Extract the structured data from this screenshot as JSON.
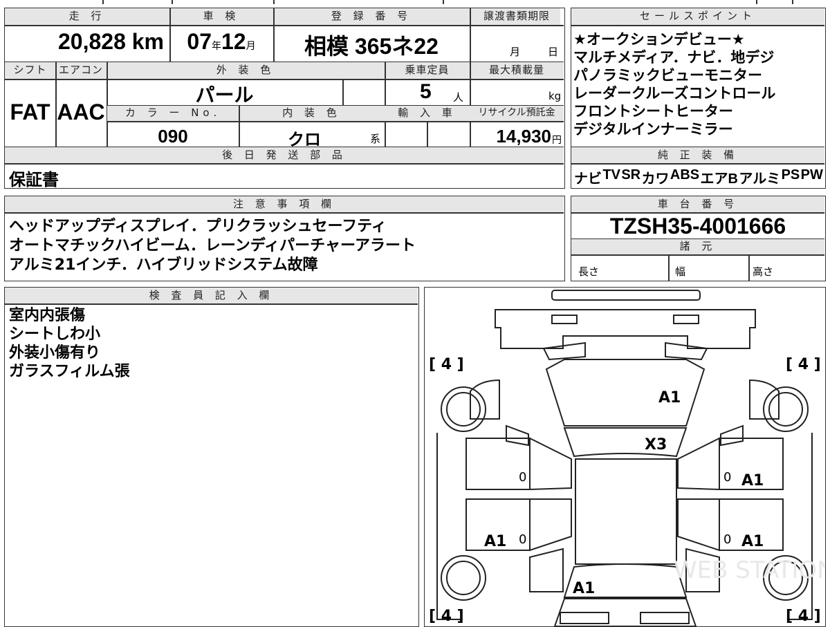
{
  "summary": {
    "mileage_header": "走 行",
    "mileage_value": "20,828",
    "mileage_unit": "km",
    "inspection_header": "車 検",
    "inspection_year": "07",
    "inspection_year_unit": "年",
    "inspection_month": "12",
    "inspection_month_unit": "月",
    "registration_header": "登 録 番 号",
    "registration_value": "相模 365ネ22",
    "transfer_header": "譲渡書類期限",
    "transfer_month_unit": "月",
    "transfer_day_unit": "日",
    "shift_header": "シフト",
    "shift_value": "FAT",
    "ac_header": "エアコン",
    "ac_value": "AAC",
    "exterior_header": "外 装 色",
    "exterior_value": "パール",
    "capacity_header": "乗車定員",
    "capacity_value": "5",
    "capacity_unit": "人",
    "load_header": "最大積載量",
    "load_unit": "kg",
    "color_no_header": "カ ラ ー No.",
    "color_no_value": "090",
    "interior_header": "内 装 色",
    "interior_value": "クロ",
    "interior_suffix": "系",
    "import_header": "輸 入 車",
    "recycle_header": "リサイクル預託金",
    "recycle_value": "14,930",
    "recycle_unit": "円",
    "later_parts_header": "後 日 発 送 部 品",
    "later_parts_value": "保証書"
  },
  "sales_points": {
    "header": "セールスポイント",
    "items": [
      "★オークションデビュー★",
      "マルチメディア．ナビ．地デジ",
      "パノラミックビューモニター",
      "レーダークルーズコントロール",
      "フロントシートヒーター",
      "デジタルインナーミラー"
    ]
  },
  "equipment": {
    "header": "純 正 装 備",
    "items": [
      "ナビ",
      "TV",
      "SR",
      "カワ",
      "ABS",
      "エアB",
      "アルミ",
      "PS",
      "PW"
    ]
  },
  "notes": {
    "header": "注 意 事 項 欄",
    "lines": [
      "ヘッドアップディスプレイ．プリクラッシュセーフティ",
      "オートマチックハイビーム．レーンディパーチャーアラート",
      "アルミ21インチ．ハイブリッドシステム故障"
    ]
  },
  "chassis": {
    "header": "車 台 番 号",
    "value": "TZSH35-4001666",
    "specs_header": "諸 元",
    "length_label": "長さ",
    "width_label": "幅",
    "height_label": "高さ"
  },
  "inspector": {
    "header": "検 査 員 記 入 欄",
    "lines": [
      "室内内張傷",
      "シートしわ小",
      "外装小傷有り",
      "ガラスフィルム張"
    ]
  },
  "diagram": {
    "tire_front_left": "[ 4 ]",
    "tire_front_right": "[ 4 ]",
    "tire_rear_left": "[ 4 ]",
    "tire_rear_right": "[ 4 ]",
    "hood_mark": "A1",
    "windshield_mark": "X3",
    "right_front_door_mark": "A1",
    "right_rear_door_mark": "A1",
    "left_rear_door_mark": "A1",
    "trunk_mark": "A1",
    "zero_mark": "0",
    "watermark": "WEB STATION.RO"
  }
}
